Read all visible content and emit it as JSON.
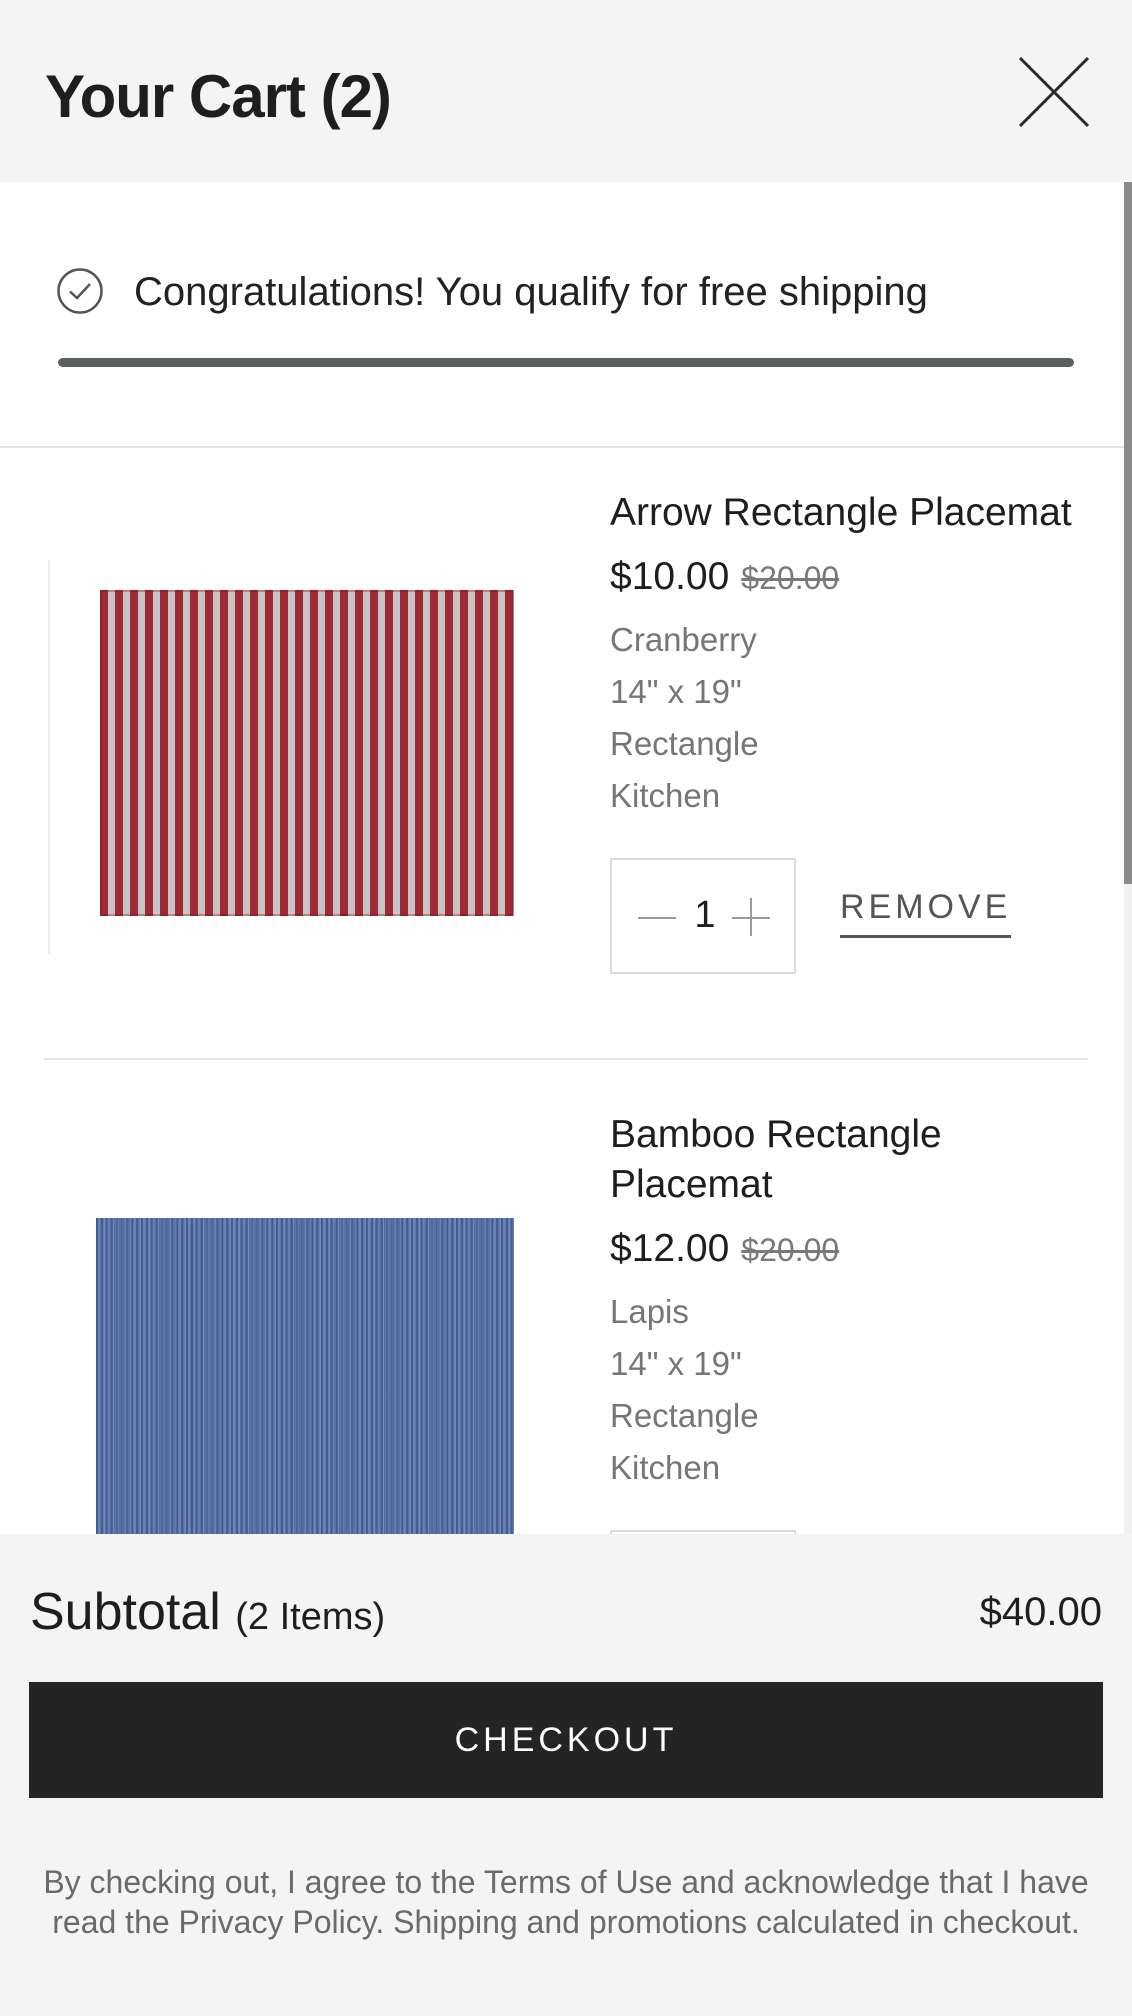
{
  "header": {
    "title": "Your Cart (2)"
  },
  "shipping": {
    "message": "Congratulations! You qualify for free shipping",
    "progress": 1.0
  },
  "items": [
    {
      "name": "Arrow Rectangle Placemat",
      "price": "$10.00",
      "original_price": "$20.00",
      "color": "Cranberry",
      "size": "14\" x 19\"",
      "shape": "Rectangle",
      "room": "Kitchen",
      "quantity": "1",
      "remove_label": "REMOVE"
    },
    {
      "name": "Bamboo Rectangle Placemat",
      "price": "$12.00",
      "original_price": "$20.00",
      "color": "Lapis",
      "size": "14\" x 19\"",
      "shape": "Rectangle",
      "room": "Kitchen"
    }
  ],
  "footer": {
    "subtotal_label": "Subtotal",
    "subtotal_count": "(2 Items)",
    "subtotal_amount": "$40.00",
    "checkout_label": "CHECKOUT",
    "legal_prefix": "By checking out, I agree to the ",
    "terms_link": "Terms of Use",
    "legal_middle": " and acknowledge that I have read the ",
    "privacy_link": "Privacy Policy",
    "legal_suffix": ". Shipping and promotions calculated in checkout."
  },
  "colors": {
    "accent": "#242424",
    "progress_fill": "#5b5f5e",
    "mat_red": "#9d2a34",
    "mat_blue": "#5b73ad"
  },
  "icons": {
    "close": "close-icon",
    "check": "check-circle-icon",
    "minus": "minus-icon",
    "plus": "plus-icon"
  }
}
